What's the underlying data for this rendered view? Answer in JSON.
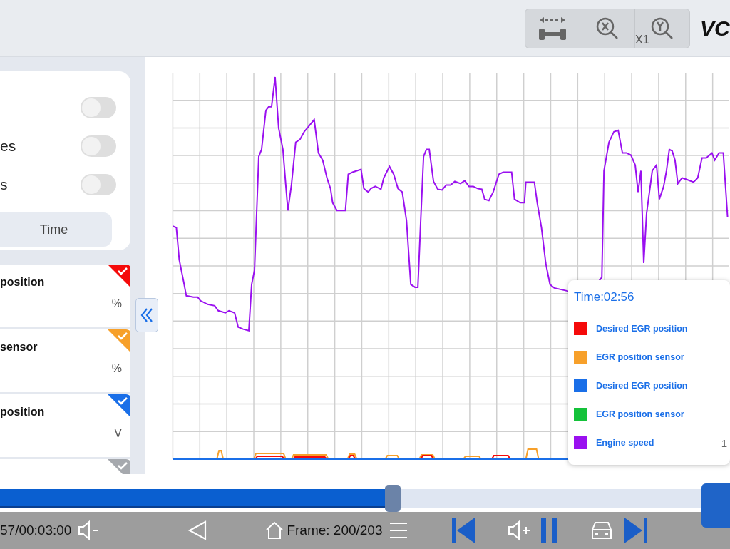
{
  "toolbar": {
    "zoom_level": "X1",
    "logo": "VC"
  },
  "settings": {
    "toggles": [
      {
        "on": false
      },
      {
        "label": "es",
        "on": false
      },
      {
        "label": "s",
        "on": false
      }
    ],
    "time_button": "Time"
  },
  "parameters": [
    {
      "name": "position",
      "unit": "%",
      "color": "#f50a0a",
      "checked": true
    },
    {
      "name": "sensor",
      "unit": "%",
      "color": "#f7a02a",
      "checked": true
    },
    {
      "name": "position",
      "unit": "V",
      "color": "#1a6fe8",
      "checked": true
    },
    {
      "color": "#a6a9ae",
      "checked": true
    }
  ],
  "tooltip": {
    "title": "Time:02:56",
    "entries": [
      {
        "name": "Desired EGR position",
        "color": "#f50a0a"
      },
      {
        "name": "EGR position sensor",
        "color": "#f7a02a"
      },
      {
        "name": "Desired EGR position",
        "color": "#1a6fe8"
      },
      {
        "name": "EGR position sensor",
        "color": "#14c23a"
      },
      {
        "name": "Engine speed",
        "color": "#9a10f0",
        "value": "1"
      }
    ]
  },
  "playback": {
    "elapsed": "57/00:03:00",
    "frame": "Frame: 200/203",
    "progress": {
      "level": 0.56
    },
    "paused": false
  }
}
